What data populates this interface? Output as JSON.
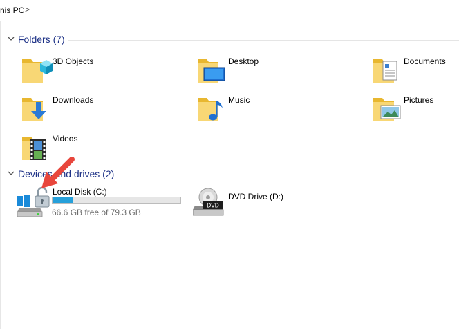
{
  "address_bar": {
    "crumb": "nis PC",
    "separator": ">"
  },
  "folders_group": {
    "title": "Folders (7)"
  },
  "folders": [
    {
      "label": "3D Objects",
      "icon": "3d-objects-icon"
    },
    {
      "label": "Desktop",
      "icon": "desktop-folder-icon"
    },
    {
      "label": "Documents",
      "icon": "documents-folder-icon"
    },
    {
      "label": "Downloads",
      "icon": "downloads-folder-icon"
    },
    {
      "label": "Music",
      "icon": "music-folder-icon"
    },
    {
      "label": "Pictures",
      "icon": "pictures-folder-icon"
    },
    {
      "label": "Videos",
      "icon": "videos-folder-icon"
    }
  ],
  "devices_group": {
    "title": "Devices and drives (2)"
  },
  "drives": [
    {
      "label": "Local Disk (C:)",
      "free_text": "66.6 GB free of 79.3 GB",
      "used_fraction": 0.16,
      "icon": "local-disk-locked-icon"
    },
    {
      "label": "DVD Drive (D:)",
      "icon": "dvd-drive-icon",
      "badge": "DVD"
    }
  ],
  "colors": {
    "group_title": "#1e3287",
    "usage_bar": "#26a0da",
    "annotation_arrow": "#e8463c"
  }
}
